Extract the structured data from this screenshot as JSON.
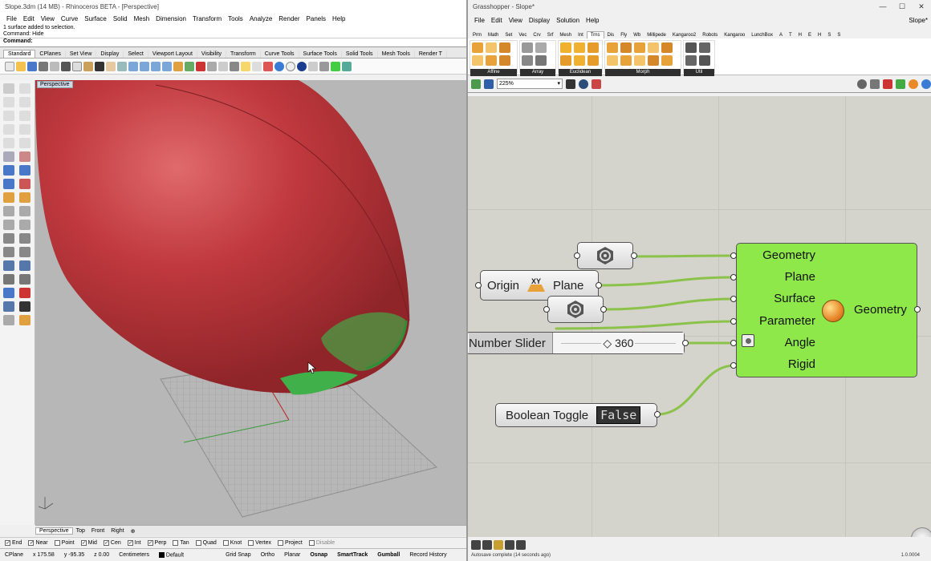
{
  "rhino": {
    "title": "Slope.3dm (14 MB) - Rhinoceros BETA - [Perspective]",
    "menu": [
      "File",
      "Edit",
      "View",
      "Curve",
      "Surface",
      "Solid",
      "Mesh",
      "Dimension",
      "Transform",
      "Tools",
      "Analyze",
      "Render",
      "Panels",
      "Help"
    ],
    "history": [
      "1 surface added to selection.",
      "Command: Hide"
    ],
    "command_prompt": "Command:",
    "toolbar_tabs": [
      "Standard",
      "CPlanes",
      "Set View",
      "Display",
      "Select",
      "Viewport Layout",
      "Visibility",
      "Transform",
      "Curve Tools",
      "Surface Tools",
      "Solid Tools",
      "Mesh Tools",
      "Render T"
    ],
    "viewport_label": "Perspective",
    "viewport_tabs": [
      "Perspective",
      "Top",
      "Front",
      "Right",
      "⊕"
    ],
    "osnaps": [
      {
        "label": "End",
        "checked": true
      },
      {
        "label": "Near",
        "checked": true
      },
      {
        "label": "Point",
        "checked": false
      },
      {
        "label": "Mid",
        "checked": true
      },
      {
        "label": "Cen",
        "checked": true
      },
      {
        "label": "Int",
        "checked": true
      },
      {
        "label": "Perp",
        "checked": true
      },
      {
        "label": "Tan",
        "checked": false
      },
      {
        "label": "Quad",
        "checked": false
      },
      {
        "label": "Knot",
        "checked": false
      },
      {
        "label": "Vertex",
        "checked": false
      },
      {
        "label": "Project",
        "checked": false
      },
      {
        "label": "Disable",
        "checked": false
      }
    ],
    "status": {
      "cplane": "CPlane",
      "x": "x 175.58",
      "y": "y -95.35",
      "z": "z 0.00",
      "units": "Centimeters",
      "layer": "Default",
      "toggles": [
        "Grid Snap",
        "Ortho",
        "Planar",
        "Osnap",
        "SmartTrack",
        "Gumball",
        "Record History"
      ]
    },
    "colors": {
      "surface": "#c0393e",
      "green_surface": "#3fb04a",
      "viewport_bg": "#b7b7b7"
    }
  },
  "grasshopper": {
    "title": "Grasshopper - Slope*",
    "doc_name": "Slope*",
    "menu": [
      "File",
      "Edit",
      "View",
      "Display",
      "Solution",
      "Help"
    ],
    "tabs": [
      "Prm",
      "Math",
      "Set",
      "Vec",
      "Crv",
      "Srf",
      "Mesh",
      "Int",
      "Trns",
      "Dis",
      "Fly",
      "Wb",
      "Millipede",
      "Kangaroo2",
      "Robots",
      "Kangaroo",
      "LunchBox",
      "A",
      "T",
      "H",
      "E",
      "H",
      "S",
      "S"
    ],
    "active_tab": "Trns",
    "panels": [
      "Affine",
      "Array",
      "Euclidean",
      "Morph",
      "Util"
    ],
    "zoom": "225%",
    "components": {
      "origin_plane": {
        "left": "Origin",
        "right": "Plane"
      },
      "number_slider": {
        "label": "Number Slider",
        "value": "◇ 360"
      },
      "boolean_toggle": {
        "label": "Boolean Toggle",
        "value": "False"
      },
      "main": {
        "inputs": [
          "Geometry",
          "Plane",
          "Surface",
          "Parameter",
          "Angle",
          "Rigid"
        ],
        "output": "Geometry"
      }
    },
    "status": "Autosave complete (14 seconds ago)",
    "version": "1.0.0004",
    "colors": {
      "component_green": "#8ee84a",
      "wire": "#8bc34a",
      "canvas": "#d4d3cc"
    }
  }
}
